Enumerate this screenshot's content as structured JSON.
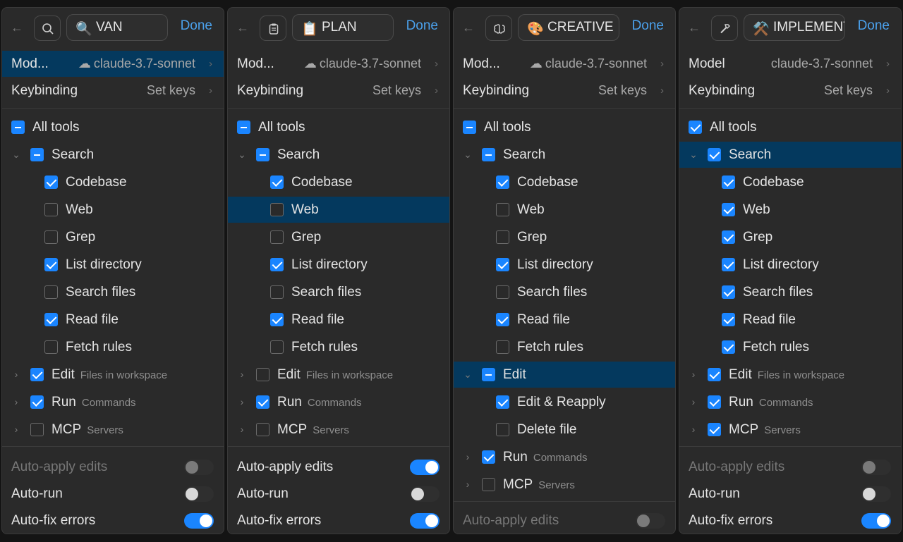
{
  "panels": [
    {
      "mode_icon": "search-icon",
      "mode_emoji": "🔍",
      "mode_name": "VAN",
      "done_label": "Done",
      "model_label": "Mod...",
      "model_value": "claude-3.7-sonnet",
      "keybinding_label": "Keybinding",
      "keybinding_value": "Set keys",
      "all_tools": "All tools",
      "search": "Search",
      "search_items": [
        "Codebase",
        "Web",
        "Grep",
        "List directory",
        "Search files",
        "Read file",
        "Fetch rules"
      ],
      "edit": "Edit",
      "edit_sub": "Files in workspace",
      "run": "Run",
      "run_sub": "Commands",
      "mcp": "MCP",
      "mcp_sub": "Servers",
      "auto_apply": "Auto-apply edits",
      "auto_run": "Auto-run",
      "auto_fix": "Auto-fix errors"
    },
    {
      "mode_icon": "clipboard-icon",
      "mode_emoji": "📋",
      "mode_name": "PLAN",
      "done_label": "Done",
      "model_label": "Mod...",
      "model_value": "claude-3.7-sonnet",
      "keybinding_label": "Keybinding",
      "keybinding_value": "Set keys",
      "all_tools": "All tools",
      "search": "Search",
      "search_items": [
        "Codebase",
        "Web",
        "Grep",
        "List directory",
        "Search files",
        "Read file",
        "Fetch rules"
      ],
      "edit": "Edit",
      "edit_sub": "Files in workspace",
      "run": "Run",
      "run_sub": "Commands",
      "mcp": "MCP",
      "mcp_sub": "Servers",
      "auto_apply": "Auto-apply edits",
      "auto_run": "Auto-run",
      "auto_fix": "Auto-fix errors"
    },
    {
      "mode_icon": "brain-icon",
      "mode_emoji": "🎨",
      "mode_name": "CREATIVE",
      "done_label": "Done",
      "model_label": "Mod...",
      "model_value": "claude-3.7-sonnet",
      "keybinding_label": "Keybinding",
      "keybinding_value": "Set keys",
      "all_tools": "All tools",
      "search": "Search",
      "search_items": [
        "Codebase",
        "Web",
        "Grep",
        "List directory",
        "Search files",
        "Read file",
        "Fetch rules"
      ],
      "edit": "Edit",
      "edit_items": [
        "Edit & Reapply",
        "Delete file"
      ],
      "run": "Run",
      "run_sub": "Commands",
      "mcp": "MCP",
      "mcp_sub": "Servers",
      "auto_apply": "Auto-apply edits"
    },
    {
      "mode_icon": "hammer-icon",
      "mode_emoji": "⚒️",
      "mode_name": "IMPLEMENT",
      "done_label": "Done",
      "model_label": "Model",
      "model_value": "claude-3.7-sonnet",
      "keybinding_label": "Keybinding",
      "keybinding_value": "Set keys",
      "all_tools": "All tools",
      "search": "Search",
      "search_items": [
        "Codebase",
        "Web",
        "Grep",
        "List directory",
        "Search files",
        "Read file",
        "Fetch rules"
      ],
      "edit": "Edit",
      "edit_sub": "Files in workspace",
      "run": "Run",
      "run_sub": "Commands",
      "mcp": "MCP",
      "mcp_sub": "Servers",
      "auto_apply": "Auto-apply edits",
      "auto_run": "Auto-run",
      "auto_fix": "Auto-fix errors"
    }
  ],
  "symbols": {
    "back": "←",
    "chev_right": "›",
    "expand": "›",
    "collapse": "⌄",
    "cloud": "☁"
  }
}
